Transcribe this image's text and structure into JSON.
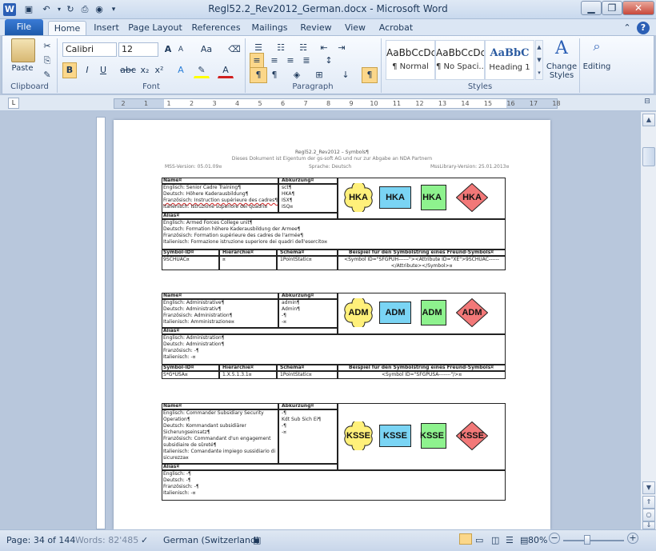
{
  "window": {
    "title": "Regl52.2_Rev2012_German.docx - Microsoft Word",
    "app_letter": "W"
  },
  "tabs": [
    {
      "label": "File"
    },
    {
      "label": "Home"
    },
    {
      "label": "Insert"
    },
    {
      "label": "Page Layout"
    },
    {
      "label": "References"
    },
    {
      "label": "Mailings"
    },
    {
      "label": "Review"
    },
    {
      "label": "View"
    },
    {
      "label": "Acrobat"
    }
  ],
  "ribbon": {
    "clipboard": {
      "paste_label": "Paste",
      "group_label": "Clipboard"
    },
    "font": {
      "font_name": "Calibri",
      "font_size": "12",
      "group_label": "Font",
      "bold": "B",
      "italic": "I",
      "underline": "U",
      "strike": "abc",
      "sub": "x₂",
      "sup": "x²",
      "grow": "A",
      "shrink": "A",
      "case": "Aa"
    },
    "paragraph": {
      "group_label": "Paragraph"
    },
    "styles": {
      "group_label": "Styles",
      "items": [
        {
          "sample": "AaBbCcDc",
          "name": "¶ Normal"
        },
        {
          "sample": "AaBbCcDc",
          "name": "¶ No Spaci..."
        },
        {
          "sample": "AaBbC",
          "name": "Heading 1"
        }
      ],
      "change_label_1": "Change",
      "change_label_2": "Styles"
    },
    "editing": {
      "label": "Editing"
    }
  },
  "ruler": {
    "numbers": [
      "2",
      "1",
      "1",
      "2",
      "3",
      "4",
      "5",
      "6",
      "7",
      "8",
      "9",
      "10",
      "11",
      "12",
      "13",
      "14",
      "15",
      "16",
      "17",
      "18"
    ]
  },
  "document": {
    "header_line1": "Regl52.2_Rev2012 – Symbols¶",
    "header_line2": "Dieses Dokument ist Eigentum der gs-soft AG und nur zur Abgabe an NDA Partnern",
    "mss_left": "MSS-Version: 05.01.09¤",
    "sprache": "Sprache: Deutsch",
    "mss_right": "MssLibrary-Version: 25.01.2013¤",
    "col_headers": {
      "name": "Name¤",
      "abk": "Abkürzung¤",
      "alias": "Alias¤",
      "symid": "Symbol-ID¤",
      "hier": "Hierarchie¤",
      "schema": "Schema¤",
      "beispiel": "Beispiel für den Symbolstring eines Freund-Symbols¤"
    },
    "blocks": [
      {
        "names": [
          "Englisch: Senior Cadre Training¶",
          "Deutsch: Höhere Kaderausbildung¶",
          "Französisch: Instruction supérieure des cadres¶",
          "Italienisch: Istruzione superiore dei quadri¤"
        ],
        "abks": [
          "sct¶",
          "HKA¶",
          "ISX¶",
          "ISQ¤"
        ],
        "symbol": "HKA",
        "alias": [
          "Englisch: Armed Forces College unit¶",
          "Deutsch: Formation höhere Kaderausbildung der Armee¶",
          "Französisch: Formation supérieure des cadres de l'armée¶",
          "Italienisch: Formazione istruzione superiore dei quadri dell'esercito¤"
        ],
        "symid": "9SCHUAC¤",
        "hier": "¤",
        "schema": "1PointStatic¤",
        "beispiel": "<Symbol ID=\"SFGPUH------\"><Attribute ID=\"XE\">9SCHUAC------</Attribute></Symbol>¤"
      },
      {
        "names": [
          "Englisch: Administrative¶",
          "Deutsch: Administrativ¶",
          "Französisch: Administration¶",
          "Italienisch: Amministrazione¤"
        ],
        "abks": [
          "admin¶",
          "Admin¶",
          "-¶",
          "-¤"
        ],
        "symbol": "ADM",
        "alias": [
          "Englisch: Administration¶",
          "Deutsch: Administration¶",
          "Französisch: -¶",
          "Italienisch: -¤"
        ],
        "symid": "S*G*USA¤",
        "hier": "1.X.5.1.3.1¤",
        "schema": "1PointStatic¤",
        "beispiel": "<Symbol ID=\"SFGPUSA-------\"/>¤"
      },
      {
        "names": [
          "Englisch: Commander Subsidiary Security",
          "Operation¶",
          "Deutsch: Kommandant subsidiärer",
          "Sicherungseinsatz¶",
          "Französisch: Commandant d'un engagement",
          "subsidiaire de sûreté¶",
          "Italienisch: Comandante impiego sussidiario di",
          "sicurezza¤"
        ],
        "abks": [
          "-¶",
          "Kdt Sub Sich Ei¶",
          "-¶",
          "-¤"
        ],
        "symbol": "KSSE",
        "alias": [
          "Englisch: -¶",
          "Deutsch: -¶",
          "Französisch: -¶",
          "Italienisch: -¤"
        ]
      }
    ]
  },
  "status": {
    "page": "Page: 34 of 144",
    "words": "Words: 82'485",
    "language": "German (Switzerland)",
    "zoom": "80%"
  },
  "colors": {
    "yellow": "#fff07a",
    "blue": "#7ad4f4",
    "green": "#8ef28e",
    "red": "#f27878",
    "accent": "#1e5aab"
  }
}
